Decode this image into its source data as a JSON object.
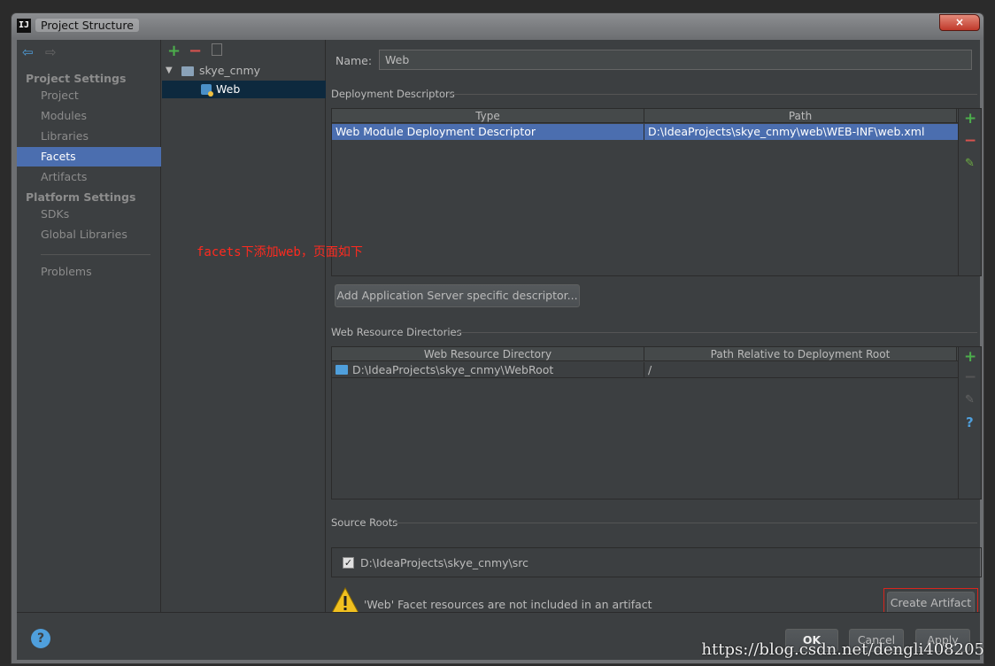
{
  "window": {
    "title": "Project Structure",
    "app_icon": "IJ",
    "close_label": "×"
  },
  "sidebar": {
    "project_settings_header": "Project Settings",
    "platform_settings_header": "Platform Settings",
    "items": [
      {
        "label": "Project",
        "selected": false
      },
      {
        "label": "Modules",
        "selected": false
      },
      {
        "label": "Libraries",
        "selected": false
      },
      {
        "label": "Facets",
        "selected": true
      },
      {
        "label": "Artifacts",
        "selected": false
      },
      {
        "label": "SDKs",
        "selected": false
      },
      {
        "label": "Global Libraries",
        "selected": false
      },
      {
        "label": "Problems",
        "selected": false
      }
    ]
  },
  "tree": {
    "module": "skye_cnmy",
    "facet": "Web"
  },
  "main": {
    "name_label": "Name:",
    "name_value": "Web",
    "deployment_descriptors": {
      "title": "Deployment Descriptors",
      "columns": [
        "Type",
        "Path"
      ],
      "rows": [
        {
          "type": "Web Module Deployment Descriptor",
          "path": "D:\\IdeaProjects\\skye_cnmy\\web\\WEB-INF\\web.xml"
        }
      ],
      "add_server_button": "Add Application Server specific descriptor..."
    },
    "web_resource_directories": {
      "title": "Web Resource Directories",
      "columns": [
        "Web Resource Directory",
        "Path Relative to Deployment Root"
      ],
      "rows": [
        {
          "directory": "D:\\IdeaProjects\\skye_cnmy\\WebRoot",
          "relative": "/"
        }
      ]
    },
    "source_roots": {
      "title": "Source Roots",
      "path": "D:\\IdeaProjects\\skye_cnmy\\src",
      "checked": true
    },
    "warning_text": "'Web' Facet resources are not included in an artifact",
    "create_artifact_button": "Create Artifact"
  },
  "footer": {
    "ok": "OK",
    "cancel": "Cancel",
    "apply": "Apply"
  },
  "annotation": "facets下添加web，页面如下",
  "watermark": "https://blog.csdn.net/dengli408205",
  "colors": {
    "selection": "#4b6eaf",
    "tree_selection": "#0d293e",
    "annotation": "#ff2a1f",
    "highlight_box": "#d9251d"
  }
}
